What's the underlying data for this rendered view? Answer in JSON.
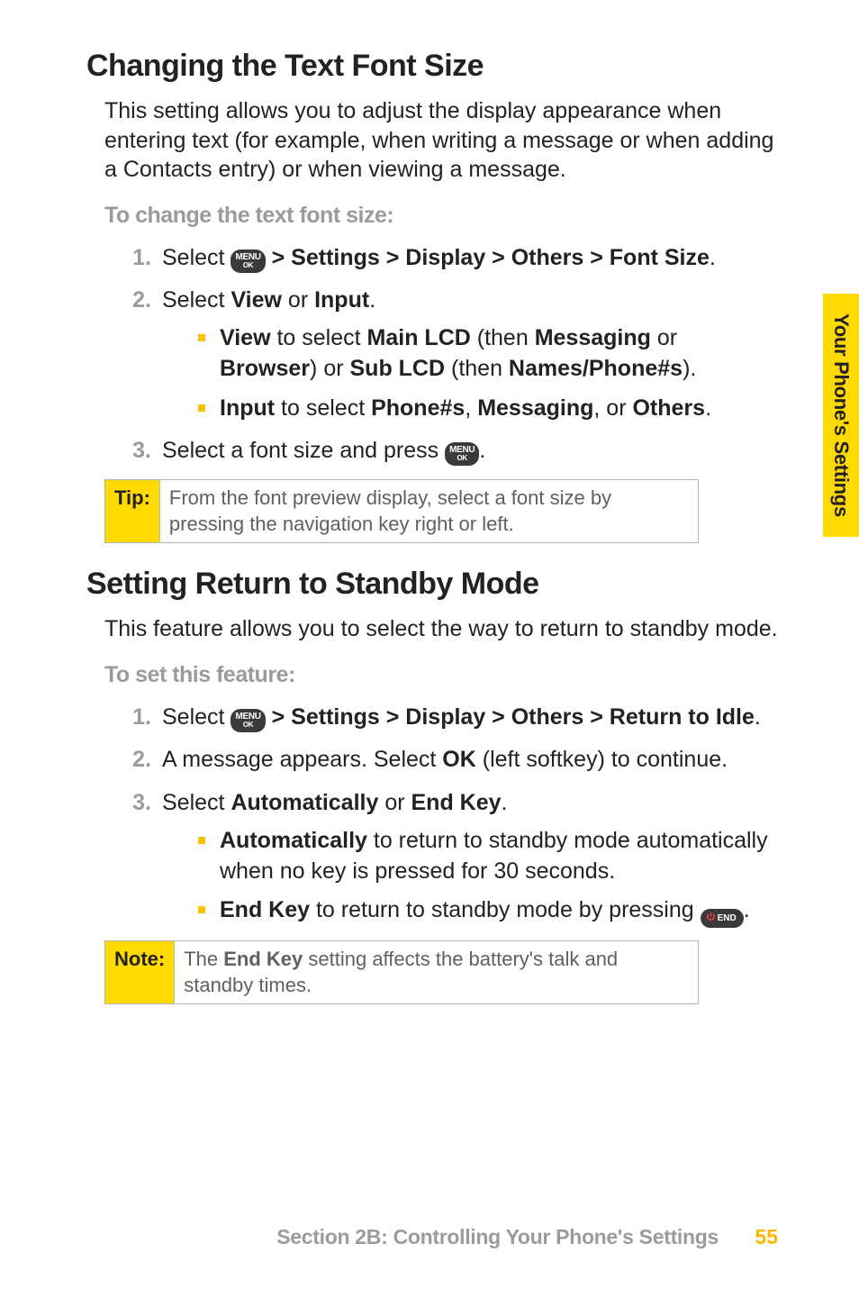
{
  "side_tab": "Your Phone's Settings",
  "sec1": {
    "title": "Changing the Text Font Size",
    "intro": "This setting allows you to adjust the display appearance when entering text (for example, when writing a message or when adding a Contacts entry) or when viewing a message.",
    "sub": "To change the text font size:",
    "step1_pre": "Select ",
    "step1_post": " > Settings > Display > Others > Font Size",
    "step2_pre": "Select ",
    "step2_view": "View",
    "step2_or": " or ",
    "step2_input": "Input",
    "b1_view": "View",
    "b1_mid1": " to select ",
    "b1_main": "Main LCD",
    "b1_mid2": " (then ",
    "b1_msg": "Messaging",
    "b1_or": " or ",
    "b1_browser": "Browser",
    "b1_mid3": ") or ",
    "b1_sub": "Sub LCD",
    "b1_mid4": " (then ",
    "b1_names": "Names/Phone#s",
    "b1_close": ").",
    "b2_input": "Input",
    "b2_mid1": " to select ",
    "b2_phone": "Phone#s",
    "b2_c1": ", ",
    "b2_msg": "Messaging",
    "b2_c2": ", or ",
    "b2_others": "Others",
    "b2_close": ".",
    "step3_pre": "Select a font size and press ",
    "step3_post": "."
  },
  "tip": {
    "label": "Tip:",
    "content": "From the font preview display, select a font size by pressing the navigation key right or left."
  },
  "sec2": {
    "title": "Setting Return to Standby Mode",
    "intro": "This feature allows you to select the way to return to standby mode.",
    "sub": "To set this feature:",
    "step1_pre": "Select ",
    "step1_post": " > Settings > Display > Others > Return to Idle",
    "step2_pre": "A message appears. Select ",
    "step2_ok": "OK",
    "step2_post": " (left softkey) to continue.",
    "step3_pre": "Select ",
    "step3_auto": "Automatically",
    "step3_or": " or ",
    "step3_end": "End Key",
    "b1_auto": "Automatically",
    "b1_rest": " to return to standby mode automatically when no key is pressed for 30 seconds.",
    "b2_end": "End Key",
    "b2_mid": " to return to standby mode by pressing ",
    "b2_close": "."
  },
  "note": {
    "label": "Note:",
    "pre": "The ",
    "endkey": "End Key",
    "post": " setting affects the battery's talk and standby times."
  },
  "footer": {
    "text": "Section 2B: Controlling Your Phone's Settings",
    "page": "55"
  },
  "icons": {
    "menu_top": "MENU",
    "menu_bot": "OK",
    "end_text": "END"
  }
}
